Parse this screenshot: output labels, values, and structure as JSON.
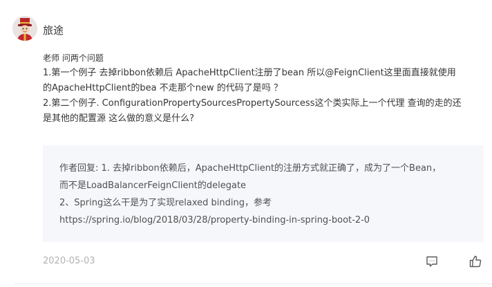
{
  "comment": {
    "author": "旅途",
    "avatar_icon": "avatar-hat-figure",
    "greeting": "老师 问两个问题",
    "lines": [
      "1.第一个例子 去掉ribbon依赖后 ApacheHttpClient注册了bean 所以@FeignClient这里面直接就使用",
      "的ApacheHttpClient的bea 不走那个new 的代码了是吗 ？",
      "2.第二个例子. ConfigurationPropertySourcesPropertySourcess这个类实际上一个代理 查询的走的还",
      "是其他的配置源 这么做的意义是什么?"
    ],
    "date": "2020-05-03"
  },
  "reply": {
    "lines": [
      "作者回复: 1. 去掉ribbon依赖后，ApacheHttpClient的注册方式就正确了，成为了一个Bean，",
      "而不是LoadBalancerFeignClient的delegate",
      "2、Spring这么干是为了实现relaxed binding，参考",
      "https://spring.io/blog/2018/03/28/property-binding-in-spring-boot-2-0"
    ],
    "background_color": "#f6f7fb"
  },
  "actions": {
    "comment_icon": "comment-icon",
    "like_icon": "thumbs-up-icon"
  },
  "colors": {
    "text": "#353535",
    "date": "#b2b2b2",
    "icon": "#595959"
  }
}
